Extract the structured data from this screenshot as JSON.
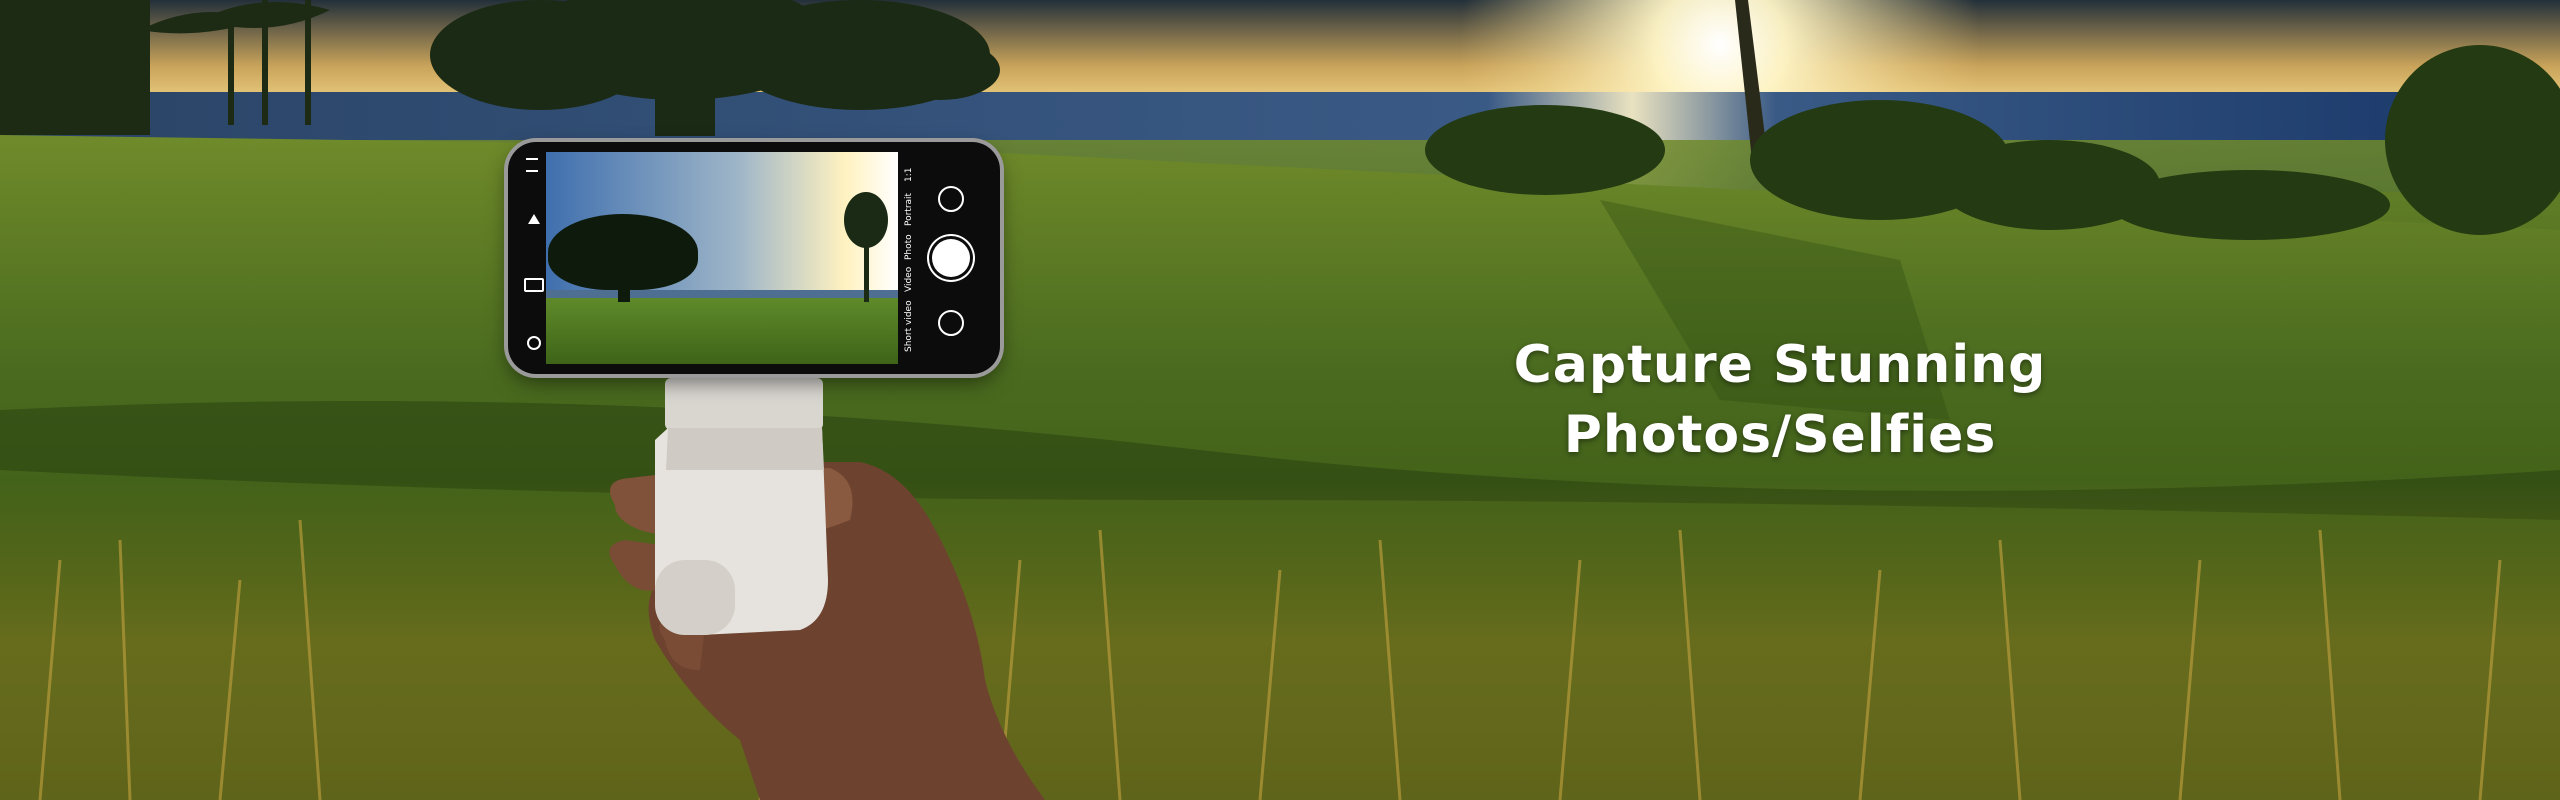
{
  "headline": {
    "line1": "Capture Stunning",
    "line2": "Photos/Selfies"
  },
  "camera_ui": {
    "modes": [
      "Short video",
      "Video",
      "Photo",
      "Portrait",
      "1:1"
    ],
    "icons": [
      "menu-icon",
      "flash-icon",
      "hdr-icon",
      "timer-icon",
      "flip-camera-icon",
      "shutter-button-icon",
      "gallery-icon"
    ]
  },
  "colors": {
    "sky_top": "#1f2a33",
    "sky_horizon": "#f2d27a",
    "sea": "#23406e",
    "grass": "#4b6e1e",
    "grass_dark": "#2f4a12",
    "grip": "#e4e1dc",
    "skin": "#7a4a32"
  }
}
